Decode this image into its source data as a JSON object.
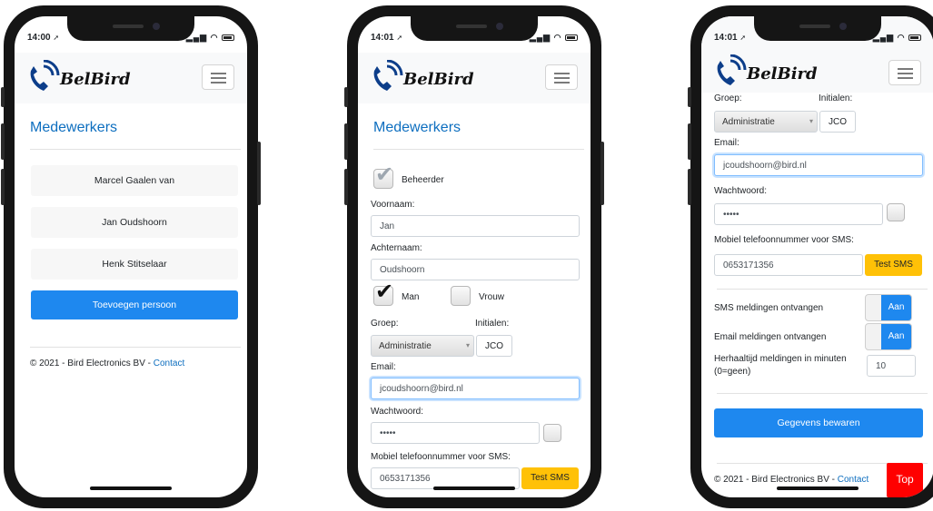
{
  "brand": {
    "name": "BelBird",
    "accent": "#1e88ef",
    "heading_color": "#0d6ebf",
    "warning": "#ffc107",
    "danger": "#ff0000"
  },
  "screens": [
    {
      "time": "14:00",
      "title": "Medewerkers",
      "persons": [
        "Marcel Gaalen van",
        "Jan Oudshoorn",
        "Henk Stitselaar"
      ],
      "add_button": "Toevoegen persoon",
      "footer_text": "© 2021 - Bird Electronics BV - ",
      "footer_link": "Contact"
    },
    {
      "time": "14:01",
      "title": "Medewerkers",
      "beheerder_label": "Beheerder",
      "beheerder_checked": true,
      "voornaam_label": "Voornaam:",
      "voornaam_value": "Jan",
      "achternaam_label": "Achternaam:",
      "achternaam_value": "Oudshoorn",
      "man_label": "Man",
      "man_checked": true,
      "vrouw_label": "Vrouw",
      "vrouw_checked": false,
      "groep_label": "Groep:",
      "groep_value": "Administratie",
      "initialen_label": "Initialen:",
      "initialen_value": "JCO",
      "email_label": "Email:",
      "email_value": "jcoudshoorn@bird.nl",
      "wachtwoord_label": "Wachtwoord:",
      "wachtwoord_value": "•••••",
      "mobiel_label": "Mobiel telefoonnummer voor SMS:",
      "mobiel_value": "0653171356",
      "test_sms_label": "Test SMS"
    },
    {
      "time": "14:01",
      "groep_label": "Groep:",
      "initialen_label": "Initialen:",
      "groep_value": "Administratie",
      "initialen_value": "JCO",
      "email_label": "Email:",
      "email_value": "jcoudshoorn@bird.nl",
      "wachtwoord_label": "Wachtwoord:",
      "wachtwoord_value": "•••••",
      "mobiel_label": "Mobiel telefoonnummer voor SMS:",
      "mobiel_value": "0653171356",
      "test_sms_label": "Test SMS",
      "sms_label": "SMS meldingen ontvangen",
      "sms_toggle": "Aan",
      "email_notif_label": "Email meldingen ontvangen",
      "email_toggle": "Aan",
      "herhaal_label": "Herhaaltijd meldingen in minuten (0=geen)",
      "herhaal_value": "10",
      "save_button": "Gegevens bewaren",
      "footer_text": "© 2021 - Bird Electronics BV - ",
      "footer_link": "Contact",
      "top_button": "Top"
    }
  ]
}
